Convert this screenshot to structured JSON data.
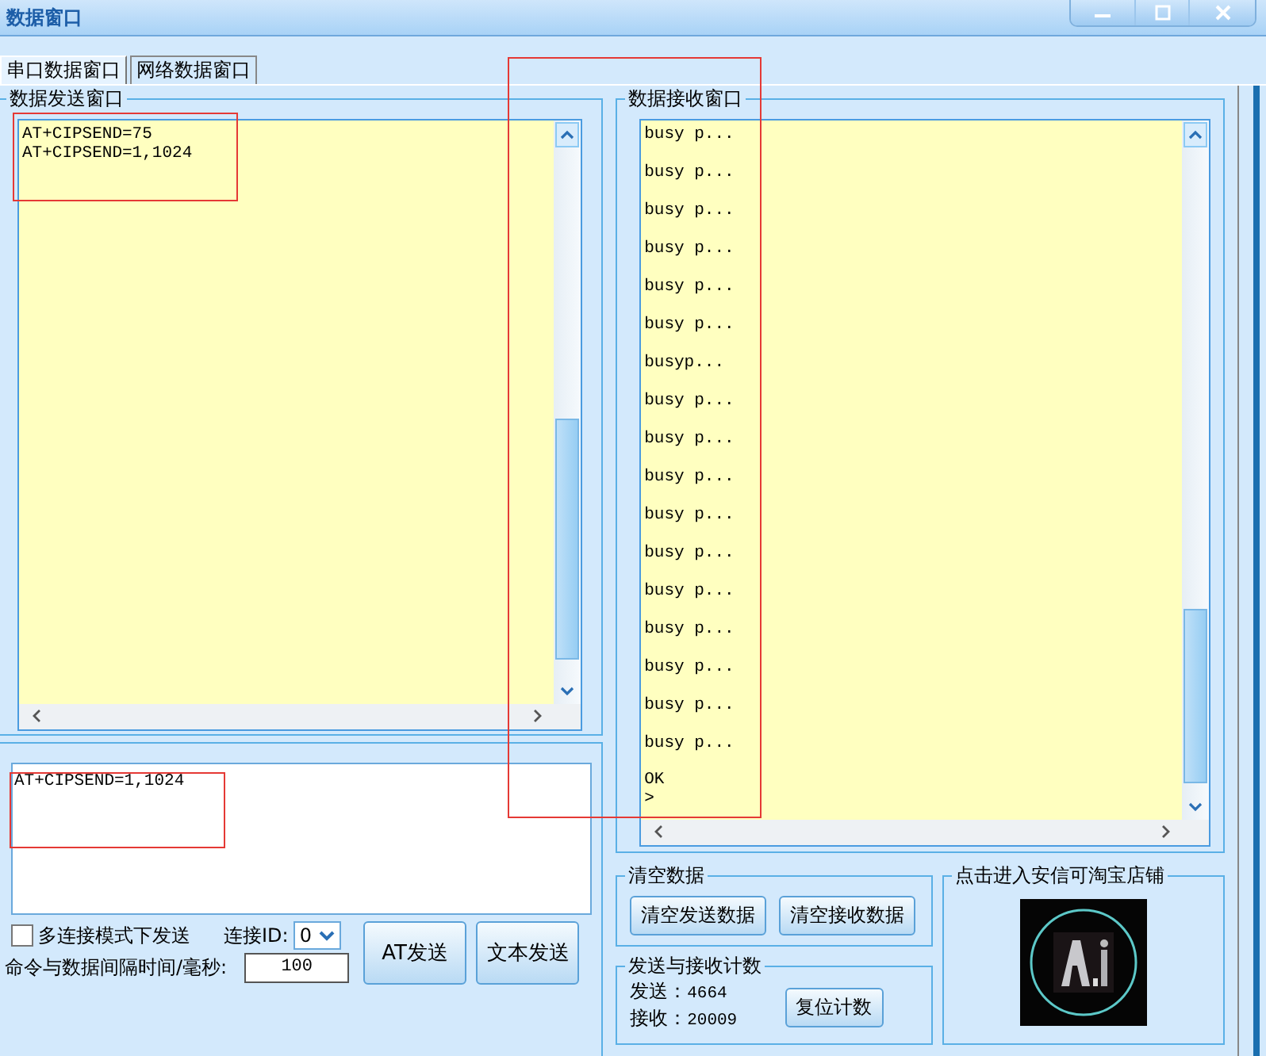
{
  "window": {
    "title": "数据窗口"
  },
  "tabs": [
    {
      "label": "串口数据窗口",
      "selected": true
    },
    {
      "label": "网络数据窗口",
      "selected": false
    }
  ],
  "send_panel": {
    "title": "数据发送窗口",
    "lines": [
      "AT+CIPSEND=75",
      "AT+CIPSEND=1,1024"
    ]
  },
  "command_box": {
    "value": "AT+CIPSEND=1,1024"
  },
  "multi_link": {
    "label": "多连接模式下发送",
    "checked": false
  },
  "link_id": {
    "label": "连接ID:",
    "value": "0"
  },
  "interval": {
    "label": "命令与数据间隔时间/毫秒:",
    "value": "100"
  },
  "buttons": [
    "AT发送",
    "文本发送"
  ],
  "receive_panel": {
    "title": "数据接收窗口",
    "lines": [
      "busy p...",
      "busy p...",
      "busy p...",
      "busy p...",
      "busy p...",
      "busy p...",
      "busyp...",
      "busy p...",
      "busy p...",
      "busy p...",
      "busy p...",
      "busy p...",
      "busy p...",
      "busy p...",
      "busy p...",
      "busy p...",
      "busy p...",
      "OK",
      ">"
    ]
  },
  "clear_group": {
    "title": "清空数据",
    "buttons": [
      "清空发送数据",
      "清空接收数据"
    ]
  },
  "count_group": {
    "title": "发送与接收计数",
    "sent_label": "发送：",
    "sent": "4664",
    "received_label": "接收：",
    "received": "20009",
    "button": "复位计数"
  },
  "shop_group": {
    "title": "点击进入安信可淘宝店铺"
  }
}
